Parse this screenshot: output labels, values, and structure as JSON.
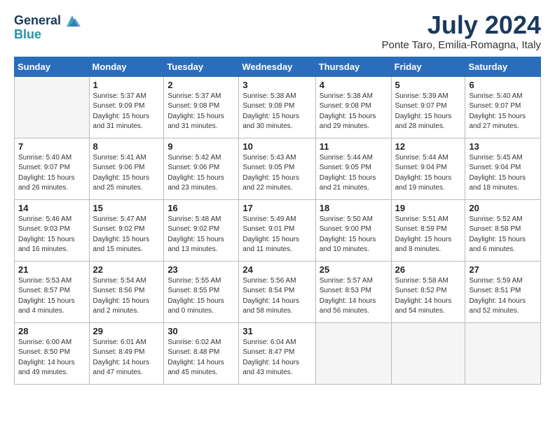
{
  "header": {
    "logo_line1": "General",
    "logo_line2": "Blue",
    "month": "July 2024",
    "location": "Ponte Taro, Emilia-Romagna, Italy"
  },
  "weekdays": [
    "Sunday",
    "Monday",
    "Tuesday",
    "Wednesday",
    "Thursday",
    "Friday",
    "Saturday"
  ],
  "weeks": [
    [
      {
        "day": "",
        "info": ""
      },
      {
        "day": "1",
        "info": "Sunrise: 5:37 AM\nSunset: 9:09 PM\nDaylight: 15 hours\nand 31 minutes."
      },
      {
        "day": "2",
        "info": "Sunrise: 5:37 AM\nSunset: 9:08 PM\nDaylight: 15 hours\nand 31 minutes."
      },
      {
        "day": "3",
        "info": "Sunrise: 5:38 AM\nSunset: 9:08 PM\nDaylight: 15 hours\nand 30 minutes."
      },
      {
        "day": "4",
        "info": "Sunrise: 5:38 AM\nSunset: 9:08 PM\nDaylight: 15 hours\nand 29 minutes."
      },
      {
        "day": "5",
        "info": "Sunrise: 5:39 AM\nSunset: 9:07 PM\nDaylight: 15 hours\nand 28 minutes."
      },
      {
        "day": "6",
        "info": "Sunrise: 5:40 AM\nSunset: 9:07 PM\nDaylight: 15 hours\nand 27 minutes."
      }
    ],
    [
      {
        "day": "7",
        "info": "Sunrise: 5:40 AM\nSunset: 9:07 PM\nDaylight: 15 hours\nand 26 minutes."
      },
      {
        "day": "8",
        "info": "Sunrise: 5:41 AM\nSunset: 9:06 PM\nDaylight: 15 hours\nand 25 minutes."
      },
      {
        "day": "9",
        "info": "Sunrise: 5:42 AM\nSunset: 9:06 PM\nDaylight: 15 hours\nand 23 minutes."
      },
      {
        "day": "10",
        "info": "Sunrise: 5:43 AM\nSunset: 9:05 PM\nDaylight: 15 hours\nand 22 minutes."
      },
      {
        "day": "11",
        "info": "Sunrise: 5:44 AM\nSunset: 9:05 PM\nDaylight: 15 hours\nand 21 minutes."
      },
      {
        "day": "12",
        "info": "Sunrise: 5:44 AM\nSunset: 9:04 PM\nDaylight: 15 hours\nand 19 minutes."
      },
      {
        "day": "13",
        "info": "Sunrise: 5:45 AM\nSunset: 9:04 PM\nDaylight: 15 hours\nand 18 minutes."
      }
    ],
    [
      {
        "day": "14",
        "info": "Sunrise: 5:46 AM\nSunset: 9:03 PM\nDaylight: 15 hours\nand 16 minutes."
      },
      {
        "day": "15",
        "info": "Sunrise: 5:47 AM\nSunset: 9:02 PM\nDaylight: 15 hours\nand 15 minutes."
      },
      {
        "day": "16",
        "info": "Sunrise: 5:48 AM\nSunset: 9:02 PM\nDaylight: 15 hours\nand 13 minutes."
      },
      {
        "day": "17",
        "info": "Sunrise: 5:49 AM\nSunset: 9:01 PM\nDaylight: 15 hours\nand 11 minutes."
      },
      {
        "day": "18",
        "info": "Sunrise: 5:50 AM\nSunset: 9:00 PM\nDaylight: 15 hours\nand 10 minutes."
      },
      {
        "day": "19",
        "info": "Sunrise: 5:51 AM\nSunset: 8:59 PM\nDaylight: 15 hours\nand 8 minutes."
      },
      {
        "day": "20",
        "info": "Sunrise: 5:52 AM\nSunset: 8:58 PM\nDaylight: 15 hours\nand 6 minutes."
      }
    ],
    [
      {
        "day": "21",
        "info": "Sunrise: 5:53 AM\nSunset: 8:57 PM\nDaylight: 15 hours\nand 4 minutes."
      },
      {
        "day": "22",
        "info": "Sunrise: 5:54 AM\nSunset: 8:56 PM\nDaylight: 15 hours\nand 2 minutes."
      },
      {
        "day": "23",
        "info": "Sunrise: 5:55 AM\nSunset: 8:55 PM\nDaylight: 15 hours\nand 0 minutes."
      },
      {
        "day": "24",
        "info": "Sunrise: 5:56 AM\nSunset: 8:54 PM\nDaylight: 14 hours\nand 58 minutes."
      },
      {
        "day": "25",
        "info": "Sunrise: 5:57 AM\nSunset: 8:53 PM\nDaylight: 14 hours\nand 56 minutes."
      },
      {
        "day": "26",
        "info": "Sunrise: 5:58 AM\nSunset: 8:52 PM\nDaylight: 14 hours\nand 54 minutes."
      },
      {
        "day": "27",
        "info": "Sunrise: 5:59 AM\nSunset: 8:51 PM\nDaylight: 14 hours\nand 52 minutes."
      }
    ],
    [
      {
        "day": "28",
        "info": "Sunrise: 6:00 AM\nSunset: 8:50 PM\nDaylight: 14 hours\nand 49 minutes."
      },
      {
        "day": "29",
        "info": "Sunrise: 6:01 AM\nSunset: 8:49 PM\nDaylight: 14 hours\nand 47 minutes."
      },
      {
        "day": "30",
        "info": "Sunrise: 6:02 AM\nSunset: 8:48 PM\nDaylight: 14 hours\nand 45 minutes."
      },
      {
        "day": "31",
        "info": "Sunrise: 6:04 AM\nSunset: 8:47 PM\nDaylight: 14 hours\nand 43 minutes."
      },
      {
        "day": "",
        "info": ""
      },
      {
        "day": "",
        "info": ""
      },
      {
        "day": "",
        "info": ""
      }
    ]
  ]
}
